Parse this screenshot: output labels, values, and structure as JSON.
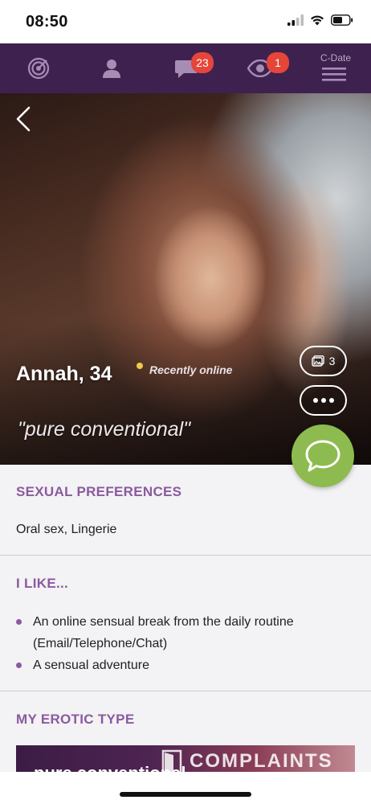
{
  "status_bar": {
    "time": "08:50"
  },
  "nav": {
    "messages_badge": "23",
    "visitors_badge": "1",
    "menu_label": "C-Date"
  },
  "profile": {
    "name": "Annah, 34",
    "status": "Recently online",
    "quote": "\"pure conventional\"",
    "photo_count": "3"
  },
  "sections": {
    "sexual_preferences": {
      "title": "SEXUAL PREFERENCES",
      "value": "Oral sex, Lingerie"
    },
    "i_like": {
      "title": "I LIKE...",
      "items": [
        "An online sensual break from the daily routine (Email/Telephone/Chat)",
        "A sensual adventure"
      ]
    },
    "erotic_type": {
      "title": "MY EROTIC TYPE",
      "banner_text": "pure conventional",
      "watermark": "COMPLAINTS"
    }
  },
  "colors": {
    "nav_bg": "#3f2150",
    "badge": "#e6453a",
    "accent_purple": "#8a5a9f",
    "chat_green": "#8dbb4f",
    "online_dot": "#f1c94a"
  },
  "icons": {
    "nav": [
      "target-icon",
      "profile-icon",
      "chat-bubble-icon",
      "eye-icon",
      "hamburger-menu-icon"
    ],
    "hero": [
      "back-chevron-icon",
      "photos-icon",
      "more-dots-icon",
      "chat-icon"
    ]
  }
}
